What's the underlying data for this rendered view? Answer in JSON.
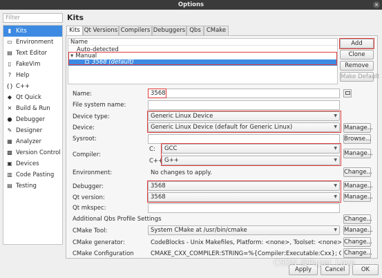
{
  "window": {
    "title": "Options",
    "close_glyph": "×"
  },
  "filter": {
    "placeholder": "Filter"
  },
  "sidebar": {
    "items": [
      {
        "label": "Kits",
        "icon": "kits-icon",
        "glyph": "▮"
      },
      {
        "label": "Environment",
        "icon": "monitor-icon",
        "glyph": "▭"
      },
      {
        "label": "Text Editor",
        "icon": "text-editor-icon",
        "glyph": "▤"
      },
      {
        "label": "FakeVim",
        "icon": "fakevim-icon",
        "glyph": "▯"
      },
      {
        "label": "Help",
        "icon": "help-icon",
        "glyph": "?"
      },
      {
        "label": "C++",
        "icon": "cpp-icon",
        "glyph": "{}"
      },
      {
        "label": "Qt Quick",
        "icon": "qt-quick-icon",
        "glyph": "◆"
      },
      {
        "label": "Build & Run",
        "icon": "build-run-icon",
        "glyph": "✕"
      },
      {
        "label": "Debugger",
        "icon": "debugger-icon",
        "glyph": "●"
      },
      {
        "label": "Designer",
        "icon": "designer-icon",
        "glyph": "✎"
      },
      {
        "label": "Analyzer",
        "icon": "analyzer-icon",
        "glyph": "▦"
      },
      {
        "label": "Version Control",
        "icon": "version-control-icon",
        "glyph": "▩"
      },
      {
        "label": "Devices",
        "icon": "devices-icon",
        "glyph": "▣"
      },
      {
        "label": "Code Pasting",
        "icon": "code-pasting-icon",
        "glyph": "▥"
      },
      {
        "label": "Testing",
        "icon": "testing-icon",
        "glyph": "▤"
      }
    ],
    "selected_index": 0
  },
  "heading": "Kits",
  "tabs": [
    "Kits",
    "Qt Versions",
    "Compilers",
    "Debuggers",
    "Qbs",
    "CMake"
  ],
  "tree": {
    "header": "Name",
    "rows": [
      {
        "label": "Auto-detected"
      },
      {
        "label": "Manual",
        "toggle": "▾"
      },
      {
        "label": "3568 (default)",
        "icon": "desktop-icon"
      }
    ]
  },
  "side_buttons": [
    "Add",
    "Clone",
    "Remove",
    "Make Default"
  ],
  "form": {
    "name": {
      "label": "Name:",
      "value": "3568"
    },
    "fs_name": {
      "label": "File system name:",
      "value": ""
    },
    "device_type": {
      "label": "Device type:",
      "value": "Generic Linux Device"
    },
    "device": {
      "label": "Device:",
      "value": "Generic Linux Device (default for Generic Linux)"
    },
    "sysroot": {
      "label": "Sysroot:",
      "value": ""
    },
    "compiler": {
      "label": "Compiler:",
      "c_label": "C:",
      "c_value": "GCC",
      "cpp_label": "C++:",
      "cpp_value": "G++"
    },
    "environment": {
      "label": "Environment:",
      "value": "No changes to apply."
    },
    "debugger": {
      "label": "Debugger:",
      "value": "3568"
    },
    "qt_version": {
      "label": "Qt version:",
      "value": "3568"
    },
    "qt_mkspec": {
      "label": "Qt mkspec:",
      "value": ""
    },
    "qbs": {
      "label": "Additional Qbs Profile Settings"
    },
    "cmake_tool": {
      "label": "CMake Tool:",
      "value": "System CMake at /usr/bin/cmake"
    },
    "cmake_generator": {
      "label": "CMake generator:",
      "value": "CodeBlocks - Unix Makefiles, Platform: <none>, Toolset: <none>"
    },
    "cmake_config": {
      "label": "CMake Configuration",
      "value": "CMAKE_CXX_COMPILER:STRING=%{Compiler:Executable:Cxx}; CMAKE_C_CO..."
    }
  },
  "buttons": {
    "manage": "Manage...",
    "browse": "Browse...",
    "change": "Change..."
  },
  "footer": {
    "apply": "Apply",
    "cancel": "Cancel",
    "ok": "OK"
  },
  "watermark": "CSDN @Paper_Love",
  "colors": {
    "selection": "#3d8ae2",
    "annotation": "#e23c3c"
  }
}
